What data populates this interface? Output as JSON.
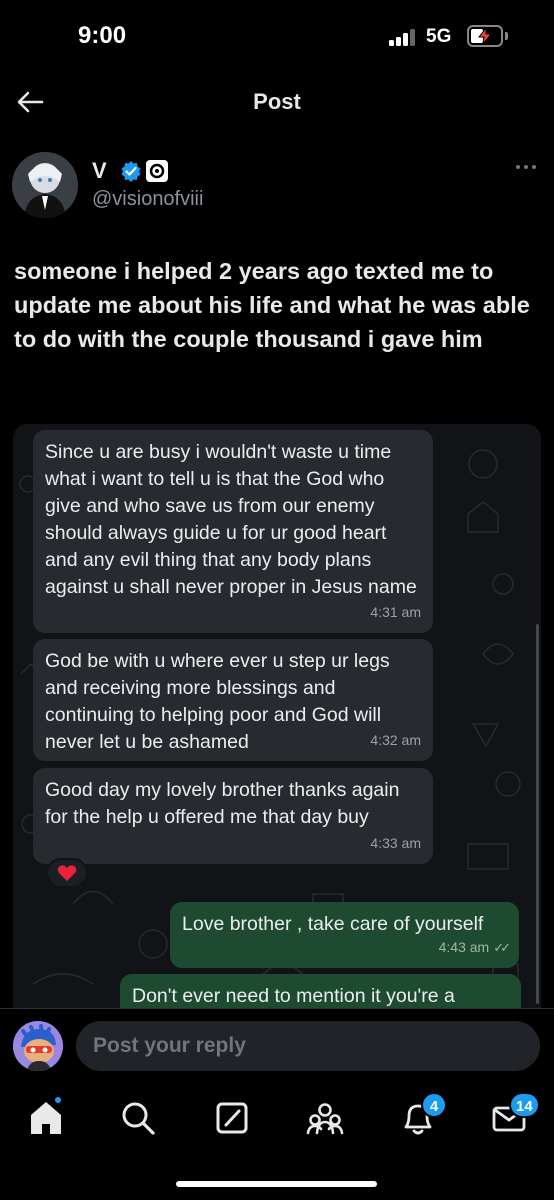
{
  "status_bar": {
    "time": "9:00",
    "network": "5G"
  },
  "header": {
    "title": "Post"
  },
  "author": {
    "name": "V",
    "handle": "@visionofviii"
  },
  "post": {
    "text": "someone i helped 2 years ago texted me to update me about his life and what he was able to do with the couple thousand i gave him"
  },
  "chat": {
    "messages": [
      {
        "direction": "in",
        "text": "Since u are busy i wouldn't waste u time what i want to tell u is that the God who give and who save us from our enemy should always guide u for ur good heart and any evil thing that any body plans against u shall never proper in Jesus name",
        "time": "4:31 am"
      },
      {
        "direction": "in",
        "text": "God be with u where ever u step ur legs and receiving more blessings and continuing to helping poor and God will never let u be ashamed",
        "time": "4:32 am"
      },
      {
        "direction": "in",
        "text": "Good day my lovely brother thanks again for the help u offered me that day buy",
        "time": "4:33 am",
        "reaction": "❤️"
      },
      {
        "direction": "out",
        "text": "Love brother , take care of yourself",
        "time": "4:43 am"
      },
      {
        "direction": "out",
        "text": "Don't ever need to mention it you're a",
        "time": ""
      }
    ]
  },
  "reply": {
    "placeholder": "Post your reply"
  },
  "tabs": {
    "notifications_badge": "4",
    "messages_badge": "14"
  },
  "colors": {
    "accent": "#1d9bf0",
    "background": "#000000",
    "outgoing_bubble": "#1f4a32",
    "incoming_bubble": "#272b30"
  }
}
